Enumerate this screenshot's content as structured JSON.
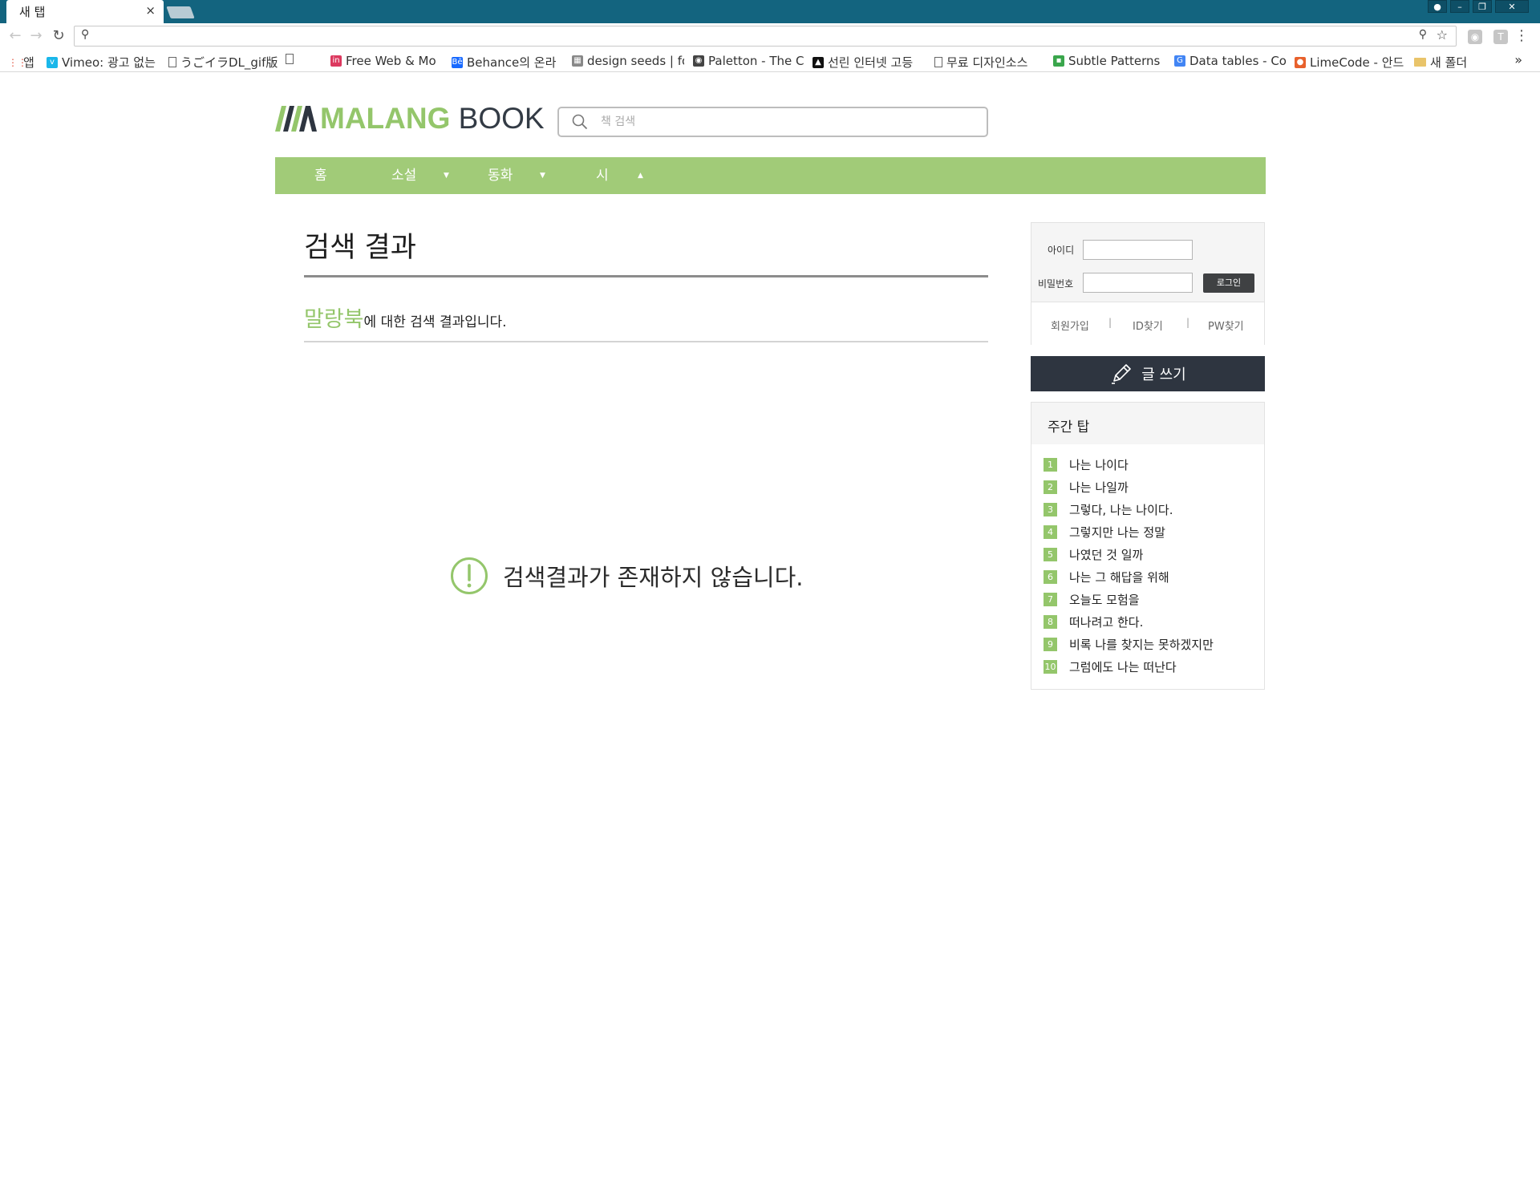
{
  "browser": {
    "tab_title": "새 탭",
    "tab_close": "×",
    "back": "←",
    "forward": "→",
    "reload": "↻",
    "window_controls": [
      "user-icon",
      "minimize-icon",
      "restore-icon",
      "close-icon"
    ],
    "bookmarks": [
      {
        "label": "앱",
        "icon": "apps-grid-icon",
        "color": "#e04f3a"
      },
      {
        "label": "Vimeo: 광고 없는",
        "icon": "vimeo-icon",
        "color": "#1ab7ea"
      },
      {
        "label": "うごイラDL_gif版",
        "icon": "page-icon",
        "color": ""
      },
      {
        "label": "",
        "icon": "page-icon",
        "color": ""
      },
      {
        "label": "Free Web & Mo",
        "icon": "invision-icon",
        "color": "#dc395f"
      },
      {
        "label": "Behance의 온라",
        "icon": "behance-icon",
        "color": "#1769ff"
      },
      {
        "label": "design seeds | fo",
        "icon": "design-seeds-icon",
        "color": "#888888"
      },
      {
        "label": "Paletton - The C",
        "icon": "paletton-icon",
        "color": "#444444"
      },
      {
        "label": "선린 인터넷 고등",
        "icon": "sunrin-icon",
        "color": "#111111"
      },
      {
        "label": "무료 디자인소스",
        "icon": "page-icon",
        "color": ""
      },
      {
        "label": "Subtle Patterns |",
        "icon": "subtle-patterns-icon",
        "color": "#3aa64c"
      },
      {
        "label": "Data tables - Co",
        "icon": "google-icon",
        "color": "#4285f4"
      },
      {
        "label": "LimeCode - 안드",
        "icon": "limecode-icon",
        "color": "#e8612c"
      },
      {
        "label": "새 폴더",
        "icon": "folder-icon",
        "color": "#e9c46a"
      }
    ],
    "bookmarks_more": "»"
  },
  "site": {
    "logo_brand": "MALANG",
    "logo_suffix": "BOOK",
    "search_placeholder": "책 검색",
    "search_value": "",
    "nav": [
      {
        "label": "홈",
        "caret": ""
      },
      {
        "label": "소설",
        "caret": "▼"
      },
      {
        "label": "동화",
        "caret": "▼"
      },
      {
        "label": "시",
        "caret": "▲"
      }
    ],
    "accent": "#a1cb78"
  },
  "results": {
    "title": "검색 결과",
    "keyword": "말랑북",
    "suffix": "에 대한 검색 결과입니다.",
    "empty_message": "검색결과가 존재하지 않습니다."
  },
  "login": {
    "id_label": "아이디",
    "pw_label": "비밀번호",
    "id_value": "",
    "pw_value": "",
    "button": "로그인",
    "links": [
      "회원가입",
      "ID찾기",
      "PW찾기"
    ],
    "separator": "|"
  },
  "write_button": "글 쓰기",
  "weekly_top": {
    "title": "주간 탑",
    "items": [
      {
        "rank": "1",
        "title": "나는 나이다"
      },
      {
        "rank": "2",
        "title": "나는 나일까"
      },
      {
        "rank": "3",
        "title": "그렇다, 나는 나이다."
      },
      {
        "rank": "4",
        "title": "그렇지만 나는 정말"
      },
      {
        "rank": "5",
        "title": "나였던 것 일까"
      },
      {
        "rank": "6",
        "title": "나는 그 해답을 위해"
      },
      {
        "rank": "7",
        "title": "오늘도 모험을"
      },
      {
        "rank": "8",
        "title": "떠나려고 한다."
      },
      {
        "rank": "9",
        "title": "비록 나를 찾지는 못하겠지만"
      },
      {
        "rank": "10",
        "title": "그럼에도 나는 떠난다"
      }
    ]
  }
}
